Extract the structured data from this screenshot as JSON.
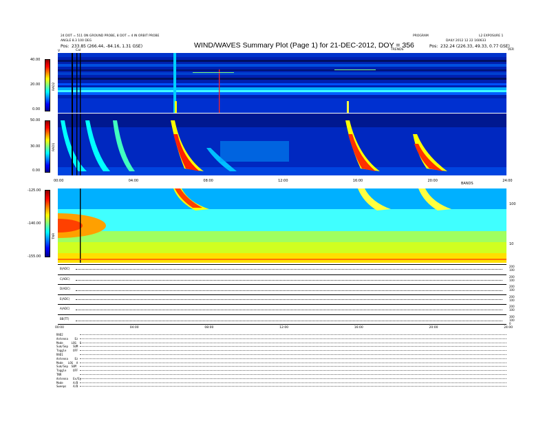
{
  "header": {
    "left_line1": "24 DOT = 511 ON GROUND PROBE, 8 DOT = 4 IN ORBIT PROBE",
    "left_line2": "ANGLE 8.3 100 DEG",
    "left_pos_label": "Pos:",
    "left_pos_value": "233.85 (266.44, -84.16, 1.31 GSE)",
    "title": "WIND/WAVES Summary Plot (Page 1) for 21-DEC-2012, DOY = 356",
    "right_line1": "PROGRAM",
    "right_line2": "DAILY 2012 12 22 160633",
    "right_code": "L2 EXPOSURE 1",
    "right_pos_label": "Pos:",
    "right_pos_value": "232.24 (226.33, 49.33, 0.77 GSE)",
    "trend_label": "TRENDS",
    "ver_label": "VER",
    "left_marker_v": "V",
    "left_marker_cal": "Cal"
  },
  "panels": {
    "rad2": {
      "name": "RAD2",
      "ticks": [
        "40.00",
        "20.00",
        "0.00"
      ]
    },
    "rad1": {
      "name": "RAD1",
      "ticks": [
        "50.00",
        "30.00",
        "0.00"
      ]
    },
    "tnr": {
      "name": "TNR",
      "ticks": [
        "-125.00",
        "-140.00",
        "-155.00"
      ],
      "right_ticks": [
        "100",
        "10"
      ],
      "bands_label": "BANDS"
    }
  },
  "time_axis": [
    "00:00",
    "04:00",
    "08:00",
    "12:00",
    "16:00",
    "20:00",
    "24:00"
  ],
  "hk_axis": [
    "00:00",
    "04:00",
    "08:00",
    "12:00",
    "16:00",
    "20:00",
    "24:00"
  ],
  "hk_rows": [
    {
      "label": "B(ADC)",
      "right_ticks": [
        "200",
        "100"
      ]
    },
    {
      "label": "C(ADC)",
      "right_ticks": [
        "200",
        "100"
      ]
    },
    {
      "label": "D(ADC)",
      "right_ticks": [
        "200",
        "100"
      ]
    },
    {
      "label": "E(ADC)",
      "right_ticks": [
        "200",
        "100"
      ]
    },
    {
      "label": "A(ADC)",
      "right_ticks": [
        "200",
        "100"
      ]
    },
    {
      "label": "BB(TT)",
      "right_ticks": [
        "300",
        "100",
        "0"
      ]
    }
  ],
  "summary_lines": [
    "RAD2",
    "Antenna    Ez",
    "Mode     LOG  S",
    "Sum/Sep   SUM",
    "Toggle    OFF",
    "RAD1",
    "Antenna    Ez",
    "Mode   LOG  A",
    "Sum/Sep  SUM",
    "Toggle    OFF",
    "TNR",
    "Antenna   Ex/Ey",
    "Mode      A/B",
    "Sweeps    A/B"
  ],
  "chart_data": {
    "type": "heatmap",
    "title": "WIND/WAVES Summary Plot (Page 1) for 21-DEC-2012, DOY = 356",
    "x_range_hours": [
      0,
      24
    ],
    "panels": [
      {
        "name": "RAD2",
        "y_range": [
          0,
          40
        ],
        "colorscale": "jet"
      },
      {
        "name": "RAD1",
        "y_range": [
          0,
          50
        ],
        "colorscale": "jet"
      },
      {
        "name": "TNR",
        "y_range": [
          -155,
          -125
        ],
        "colorscale": "jet"
      }
    ],
    "colors": {
      "low": "#00008f",
      "mid": "#00ffff",
      "high": "#ff0000"
    }
  }
}
